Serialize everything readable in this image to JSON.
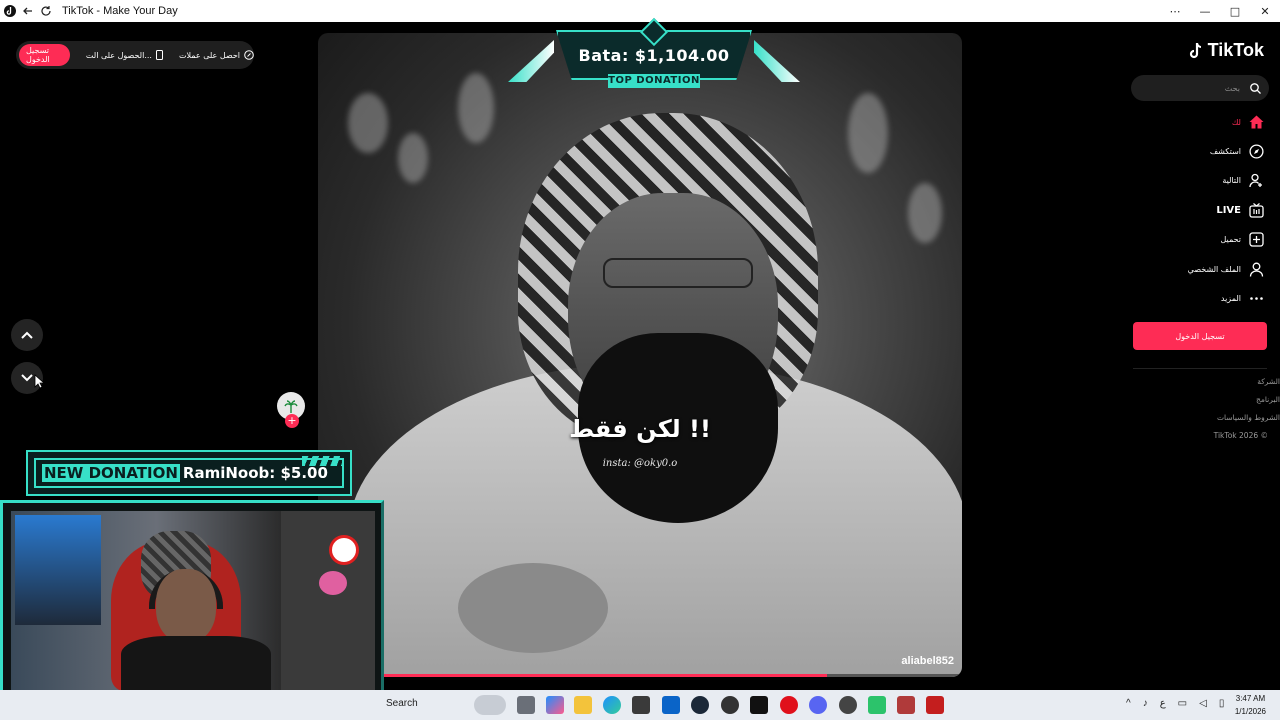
{
  "window": {
    "title": "TikTok - Make Your Day",
    "min": "—",
    "max": "□",
    "close": "✕",
    "more": "⋯"
  },
  "header": {
    "login_pill": "تسجيل الدخول",
    "get_app": "الحصول على الت...",
    "get_coins": "احصل على عملات"
  },
  "video": {
    "caption": "لكن فقط !!",
    "insta": "insta: @oky0.o",
    "username": "aliabel852",
    "progress": 0.79
  },
  "overlays": {
    "top_donation_amount": "Bata: $1,104.00",
    "top_donation_label": "TOP DONATION",
    "new_donation_label": "NEW DONATION",
    "new_donation_text": "RamiNoob: $5.00"
  },
  "sidebar": {
    "logo": "TikTok",
    "search_placeholder": "بحث",
    "items": [
      {
        "label": "لك",
        "icon": "home-icon",
        "active": true
      },
      {
        "label": "استكشف",
        "icon": "compass-icon"
      },
      {
        "label": "التالية",
        "icon": "user-plus-icon"
      },
      {
        "label": "LIVE",
        "icon": "live-icon"
      },
      {
        "label": "تحميل",
        "icon": "upload-icon"
      },
      {
        "label": "الملف الشخصي",
        "icon": "profile-icon"
      },
      {
        "label": "المزيد",
        "icon": "more-icon"
      }
    ],
    "login_button": "تسجيل الدخول",
    "footer": [
      "الشركة",
      "البرنامج",
      "الشروط والسياسات",
      "TikTok 2026 ©"
    ]
  },
  "taskbar": {
    "search": "Search",
    "time": "3:47 AM",
    "date": "1/1/2026",
    "lang": "ع"
  },
  "colors": {
    "accent": "#fe2c55",
    "overlay": "#37e0c8"
  }
}
